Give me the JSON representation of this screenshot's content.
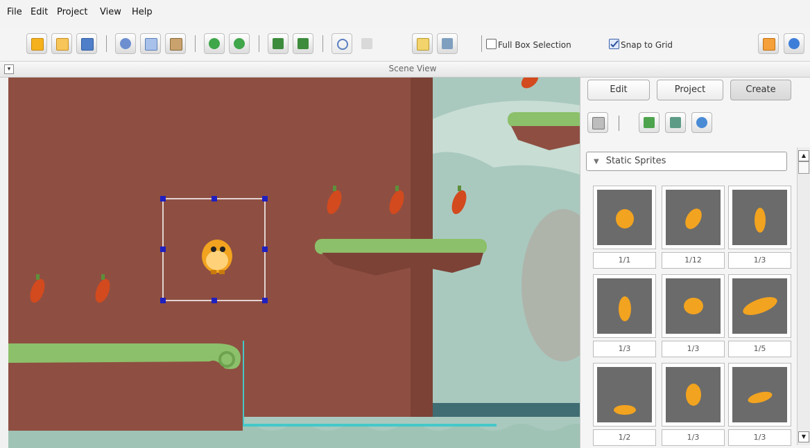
{
  "menu": {
    "items": [
      "File",
      "Edit",
      "Project",
      "View",
      "Help"
    ]
  },
  "toolbar": {
    "full_box_selection_label": "Full Box Selection",
    "full_box_selection_checked": false,
    "snap_to_grid_label": "Snap to Grid",
    "snap_to_grid_checked": true,
    "icons": [
      "new-icon",
      "open-icon",
      "save-icon",
      "cut-icon",
      "copy-icon",
      "paste-icon",
      "undo-icon",
      "redo-icon",
      "bring-forward-icon",
      "send-backward-icon",
      "target-icon",
      "pointer-icon",
      "edit-note-icon",
      "monitor-icon",
      "message-icon",
      "info-icon"
    ]
  },
  "scene_view": {
    "collapse_glyph": "▾",
    "title": "Scene View"
  },
  "panel": {
    "tabs": [
      "Edit",
      "Project",
      "Create"
    ],
    "active_tab": "Create",
    "category": {
      "arrow": "▼",
      "label": "Static Sprites"
    },
    "sprites": [
      {
        "label": "1/1"
      },
      {
        "label": "1/12"
      },
      {
        "label": "1/3"
      },
      {
        "label": "1/3"
      },
      {
        "label": "1/3"
      },
      {
        "label": "1/5"
      },
      {
        "label": "1/2"
      },
      {
        "label": "1/3"
      },
      {
        "label": "1/3"
      }
    ],
    "scroll": {
      "up": "▲",
      "down": "▼"
    }
  },
  "colors": {
    "wall": "#8e4f42",
    "grass": "#8cc06a",
    "water": "#3f6d73",
    "selection": "#2020c0",
    "pepper": "#d24a1e",
    "character": "#f2a31f"
  }
}
